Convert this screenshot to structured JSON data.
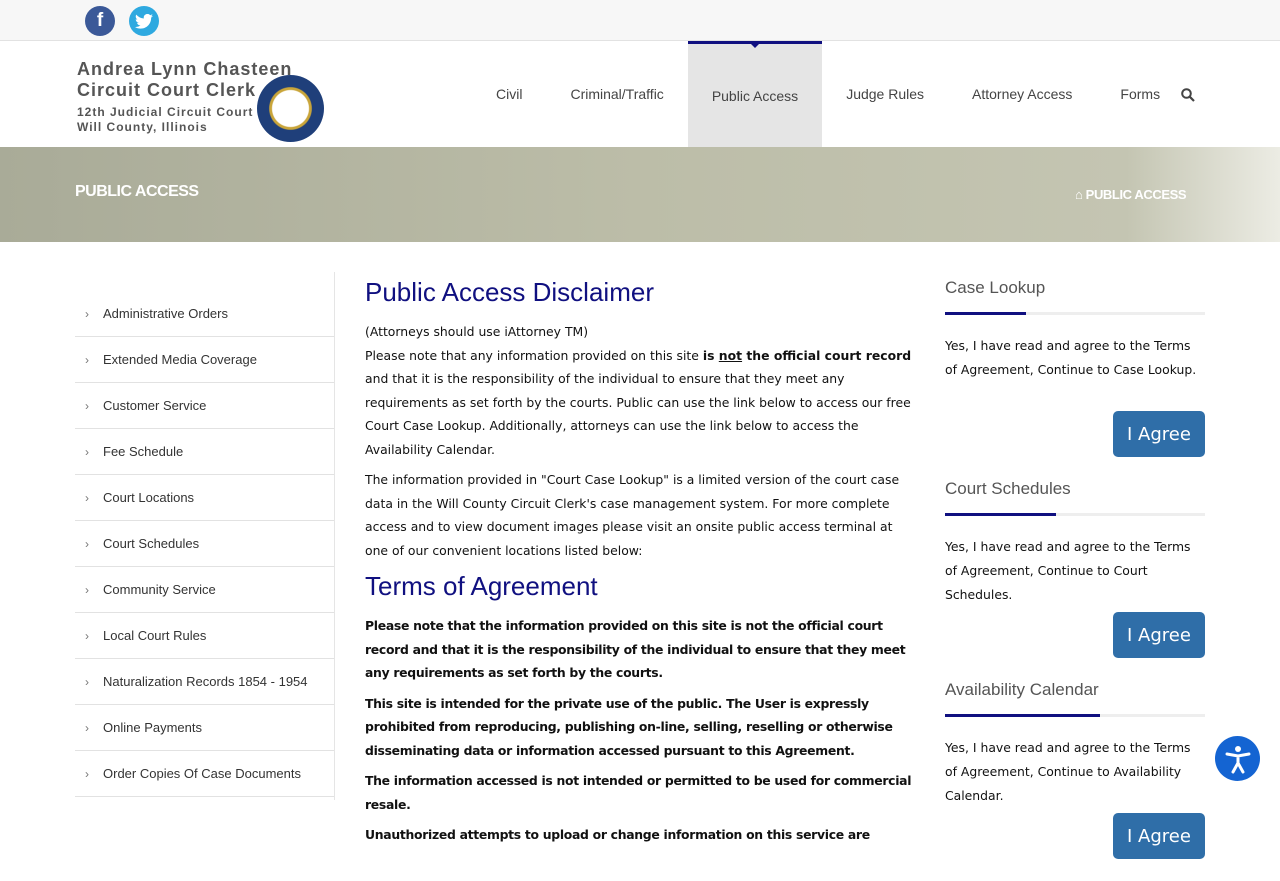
{
  "social": {
    "facebook_icon": "facebook-icon",
    "twitter_icon": "twitter-icon",
    "facebook_glyph": "f",
    "twitter_glyph": "t"
  },
  "logo": {
    "line1": "Andrea Lynn Chasteen",
    "line2": "Circuit Court Clerk",
    "line3": "12th Judicial Circuit Court",
    "line4": "Will County, Illinois"
  },
  "nav": {
    "items": [
      "Civil",
      "Criminal/Traffic",
      "Public Access",
      "Judge Rules",
      "Attorney Access",
      "Forms"
    ],
    "active": "Public Access"
  },
  "banner": {
    "title": "PUBLIC ACCESS",
    "breadcrumb": "PUBLIC ACCESS"
  },
  "sidebar": {
    "items": [
      "Administrative Orders",
      "Extended Media Coverage",
      "Customer Service",
      "Fee Schedule",
      "Court Locations",
      "Court Schedules",
      "Community Service",
      "Local Court Rules",
      "Naturalization Records 1854 - 1954",
      "Online Payments",
      "Order Copies Of Case Documents"
    ]
  },
  "main": {
    "title": "Public Access Disclaimer",
    "p0": "(Attorneys should use iAttorney TM)",
    "p1a": "Please note that any information provided on this site ",
    "p1b": "is ",
    "p1c": "not",
    "p1d": " the official court record",
    "p1e": " and that it is the responsibility of the individual to ensure that they meet any requirements as set forth by the courts. Public can use the link below to access our free Court Case Lookup.  Additionally, attorneys can use the link below to access the Availability Calendar.",
    "p2": "The information provided in \"Court Case Lookup\" is a limited version of the court case data in the Will County Circuit Clerk's case management system. For more complete access and to view document images please visit an onsite public access terminal at one of our convenient locations listed below:",
    "terms_title": "Terms of Agreement",
    "t1": "Please note that the information provided on this site is not the official court record and that it is the responsibility of the individual to ensure that they meet any requirements as set forth by the courts.",
    "t2": "This site is intended for the private use of the public. The User is expressly prohibited from reproducing, publishing on-line, selling, reselling or otherwise disseminating data or information accessed pursuant to this Agreement.",
    "t3": "The information accessed is not intended or permitted to be used for commercial resale.",
    "t4": "Unauthorized attempts to upload or change information on this service are"
  },
  "widgets": [
    {
      "title": "Case Lookup",
      "text": "Yes, I have read and agree to the Terms of Agreement,  Continue to Case Lookup.",
      "button": "I Agree"
    },
    {
      "title": "Court Schedules",
      "text": "Yes, I have read and agree to the Terms of Agreement,  Continue to Court Schedules.",
      "button": "I Agree"
    },
    {
      "title": "Availability Calendar",
      "text": "Yes, I have read and agree to the Terms of Agreement,  Continue to Availability Calendar.",
      "button": "I Agree"
    }
  ],
  "colors": {
    "accent": "#101080",
    "button": "#2f6ea8",
    "accessibility": "#1464d2"
  }
}
